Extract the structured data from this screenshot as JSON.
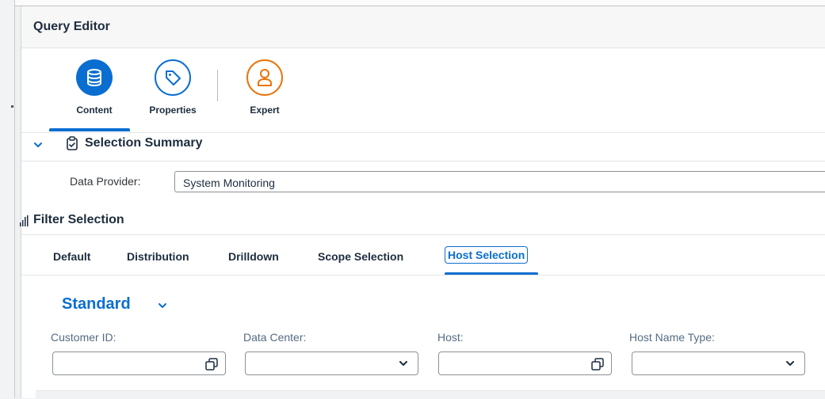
{
  "app": {
    "title": "Query Editor"
  },
  "iconbar": {
    "items": [
      {
        "label": "Content",
        "icon": "database-icon",
        "active": true
      },
      {
        "label": "Properties",
        "icon": "tag-icon",
        "active": false
      },
      {
        "label": "Expert",
        "icon": "person-icon",
        "active": false
      }
    ]
  },
  "selection_summary": {
    "title": "Selection Summary",
    "data_provider_label": "Data Provider:",
    "data_provider_value": "System Monitoring"
  },
  "filter_selection": {
    "title": "Filter Selection",
    "tabs": [
      {
        "label": "Default"
      },
      {
        "label": "Distribution"
      },
      {
        "label": "Drilldown"
      },
      {
        "label": "Scope Selection"
      },
      {
        "label": "Host Selection",
        "selected": true
      }
    ],
    "variant": "Standard",
    "fields": [
      {
        "label": "Customer ID:",
        "value": "",
        "control": "value-help"
      },
      {
        "label": "Data Center:",
        "value": "",
        "control": "dropdown"
      },
      {
        "label": "Host:",
        "value": "",
        "control": "value-help"
      },
      {
        "label": "Host Name Type:",
        "value": "",
        "control": "dropdown"
      }
    ]
  },
  "colors": {
    "accent": "#0a6ed1",
    "expert": "#e9730c",
    "text": "#1d2d3e"
  }
}
